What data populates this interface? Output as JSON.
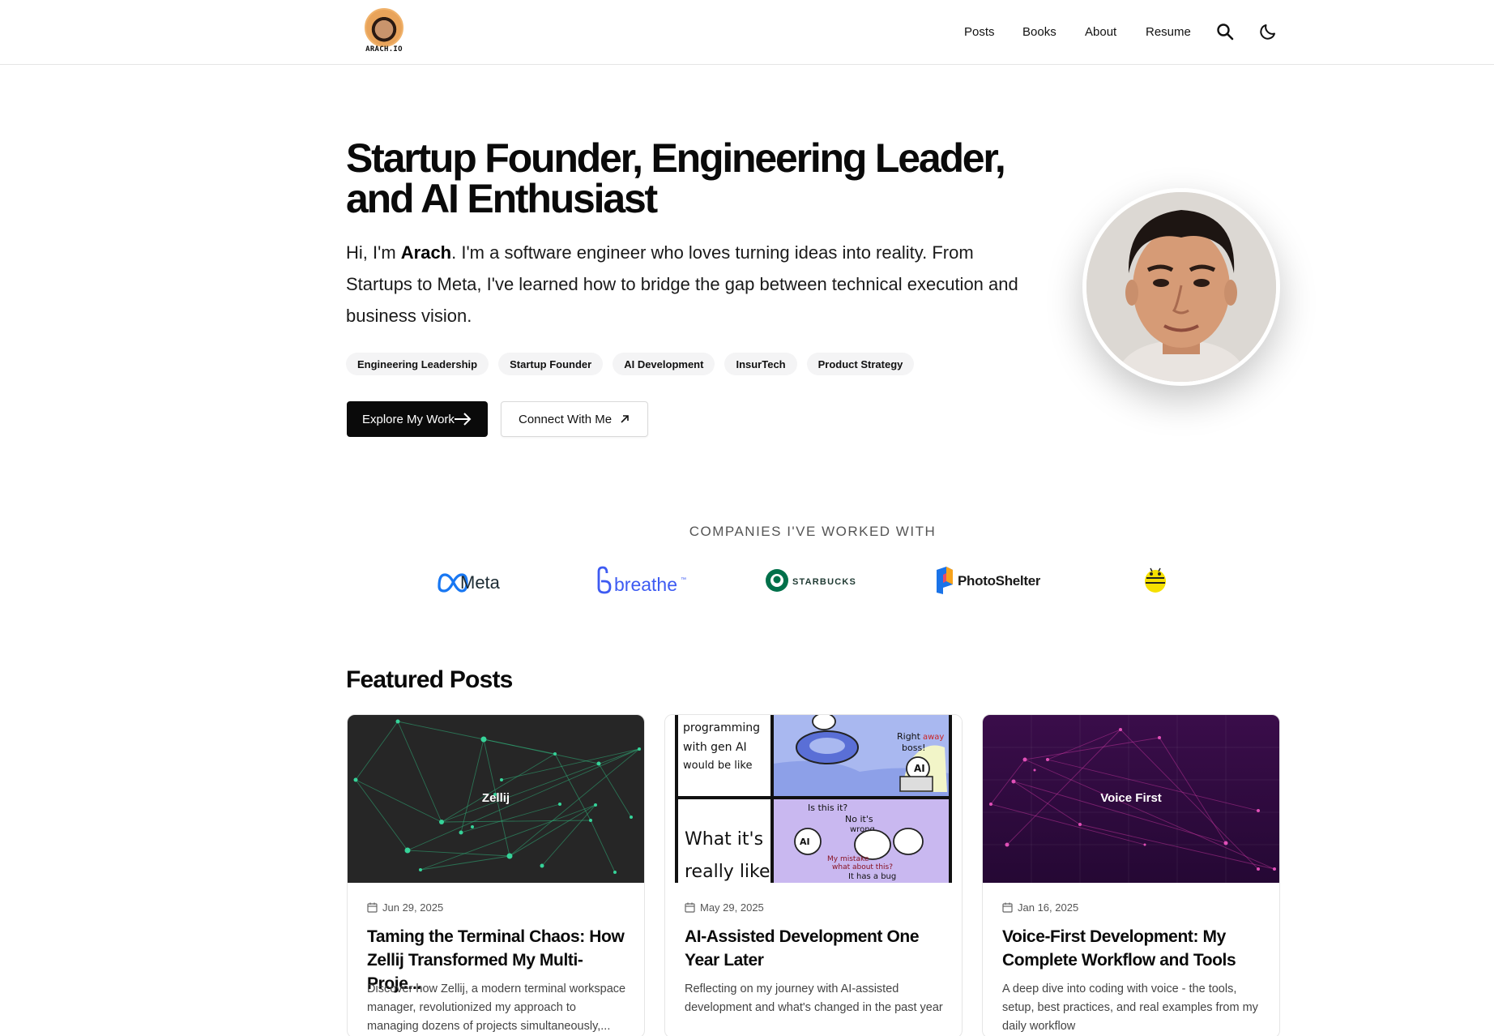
{
  "site": {
    "logo_text": "ARACH.IO"
  },
  "nav": {
    "posts": "Posts",
    "books": "Books",
    "about": "About",
    "resume": "Resume",
    "search_icon": "search-icon",
    "theme_icon": "moon-icon"
  },
  "hero": {
    "title_line1": "Startup Founder, Engineering Leader,",
    "title_line2": "and AI Enthusiast",
    "intro_prefix": "Hi, I'm ",
    "intro_name": "Arach",
    "intro_suffix": ". I'm a software engineer who loves turning ideas into reality. From Startups to Meta, I've learned how to bridge the gap between technical execution and business vision.",
    "tags": [
      "Engineering Leadership",
      "Startup Founder",
      "AI Development",
      "InsurTech",
      "Product Strategy"
    ],
    "primary_button": "Explore My Work",
    "secondary_button": "Connect With Me"
  },
  "companies": {
    "heading": "COMPANIES I'VE WORKED WITH",
    "logos": [
      "Meta",
      "breathe",
      "STARBUCKS",
      "PhotoShelter"
    ]
  },
  "featured": {
    "heading": "Featured Posts",
    "posts": [
      {
        "image_label": "Zellij",
        "date": "Jun 29, 2025",
        "title": "Taming the Terminal Chaos: How Zellij Transformed My Multi-Proje...",
        "description": "Discover how Zellij, a modern terminal workspace manager, revolutionized my approach to managing dozens of projects simultaneously,..."
      },
      {
        "image_text_1": "programming with gen AI would be like",
        "image_text_2": "What it's really like",
        "image_bubble_1": "Right away boss!",
        "image_bubble_2": "Is this it?",
        "image_bubble_3": "No it's wrong",
        "image_bubble_4": "My mistake what about this?",
        "image_bubble_5": "It has a bug",
        "date": "May 29, 2025",
        "title": "AI-Assisted Development One Year Later",
        "description": "Reflecting on my journey with AI-assisted development and what's changed in the past year"
      },
      {
        "image_label": "Voice First",
        "date": "Jan 16, 2025",
        "title": "Voice-First Development: My Complete Workflow and Tools",
        "description": "A deep dive into coding with voice - the tools, setup, best practices, and real examples from my daily workflow"
      }
    ]
  }
}
